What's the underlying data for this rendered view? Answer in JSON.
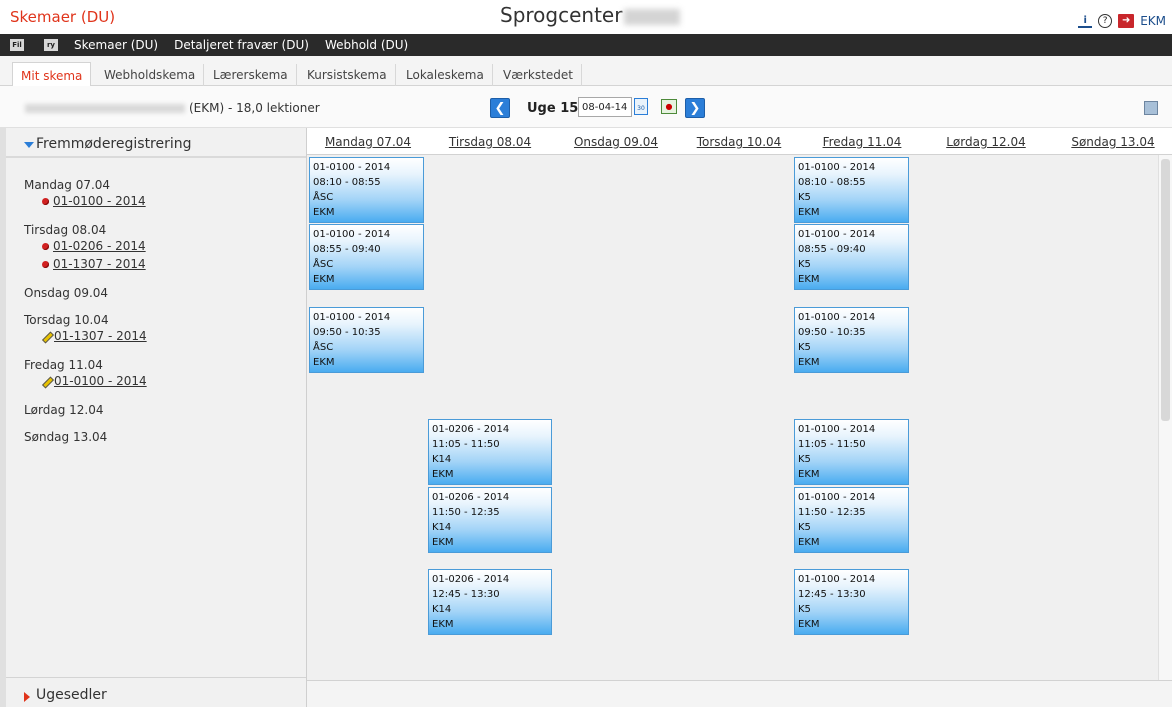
{
  "app": {
    "title": "Skemaer (DU)",
    "center_title": "Sprogcenter",
    "user_short": "EKM"
  },
  "menu": {
    "mini_icons": [
      "Fil",
      "ry"
    ],
    "items": [
      "Skemaer (DU)",
      "Detaljeret fravær (DU)",
      "Webhold (DU)"
    ]
  },
  "tabs": [
    "Mit skema",
    "Webholdskema",
    "Lærerskema",
    "Kursistskema",
    "Lokaleskema",
    "Værkstedet"
  ],
  "toolbar": {
    "user_info_suffix": "(EKM) - 18,0 lektioner",
    "week_label": "Uge 15",
    "date_value": "08-04-14"
  },
  "sidebar": {
    "section_title": "Fremmøderegistrering",
    "days": [
      {
        "label": "Mandag 07.04",
        "links": [
          {
            "text": "01-0100 - 2014",
            "status": "dot"
          }
        ]
      },
      {
        "label": "Tirsdag 08.04",
        "links": [
          {
            "text": "01-0206 - 2014",
            "status": "dot"
          },
          {
            "text": "01-1307 - 2014",
            "status": "dot"
          }
        ]
      },
      {
        "label": "Onsdag 09.04",
        "links": []
      },
      {
        "label": "Torsdag 10.04",
        "links": [
          {
            "text": "01-1307 - 2014",
            "status": "pencil"
          }
        ]
      },
      {
        "label": "Fredag 11.04",
        "links": [
          {
            "text": "01-0100 - 2014",
            "status": "pencil"
          }
        ]
      },
      {
        "label": "Lørdag 12.04",
        "links": []
      },
      {
        "label": "Søndag 13.04",
        "links": []
      }
    ],
    "footer_title": "Ugesedler"
  },
  "calendar": {
    "days": [
      "Mandag 07.04",
      "Tirsdag 08.04",
      "Onsdag 09.04",
      "Torsdag 10.04",
      "Fredag 11.04",
      "Lørdag 12.04",
      "Søndag 13.04"
    ],
    "lessons": [
      {
        "day": 0,
        "slot": 0,
        "code": "01-0100 - 2014",
        "time": "08:10 - 08:55",
        "room": "ÅSC",
        "teacher": "EKM"
      },
      {
        "day": 0,
        "slot": 1,
        "code": "01-0100 - 2014",
        "time": "08:55 - 09:40",
        "room": "ÅSC",
        "teacher": "EKM"
      },
      {
        "day": 0,
        "slot": 2,
        "code": "01-0100 - 2014",
        "time": "09:50 - 10:35",
        "room": "ÅSC",
        "teacher": "EKM"
      },
      {
        "day": 1,
        "slot": 3,
        "code": "01-0206 - 2014",
        "time": "11:05 - 11:50",
        "room": "K14",
        "teacher": "EKM"
      },
      {
        "day": 1,
        "slot": 4,
        "code": "01-0206 - 2014",
        "time": "11:50 - 12:35",
        "room": "K14",
        "teacher": "EKM"
      },
      {
        "day": 1,
        "slot": 5,
        "code": "01-0206 - 2014",
        "time": "12:45 - 13:30",
        "room": "K14",
        "teacher": "EKM"
      },
      {
        "day": 4,
        "slot": 0,
        "code": "01-0100 - 2014",
        "time": "08:10 - 08:55",
        "room": "K5",
        "teacher": "EKM"
      },
      {
        "day": 4,
        "slot": 1,
        "code": "01-0100 - 2014",
        "time": "08:55 - 09:40",
        "room": "K5",
        "teacher": "EKM"
      },
      {
        "day": 4,
        "slot": 2,
        "code": "01-0100 - 2014",
        "time": "09:50 - 10:35",
        "room": "K5",
        "teacher": "EKM"
      },
      {
        "day": 4,
        "slot": 3,
        "code": "01-0100 - 2014",
        "time": "11:05 - 11:50",
        "room": "K5",
        "teacher": "EKM"
      },
      {
        "day": 4,
        "slot": 4,
        "code": "01-0100 - 2014",
        "time": "11:50 - 12:35",
        "room": "K5",
        "teacher": "EKM"
      },
      {
        "day": 4,
        "slot": 5,
        "code": "01-0100 - 2014",
        "time": "12:45 - 13:30",
        "room": "K5",
        "teacher": "EKM"
      }
    ]
  }
}
